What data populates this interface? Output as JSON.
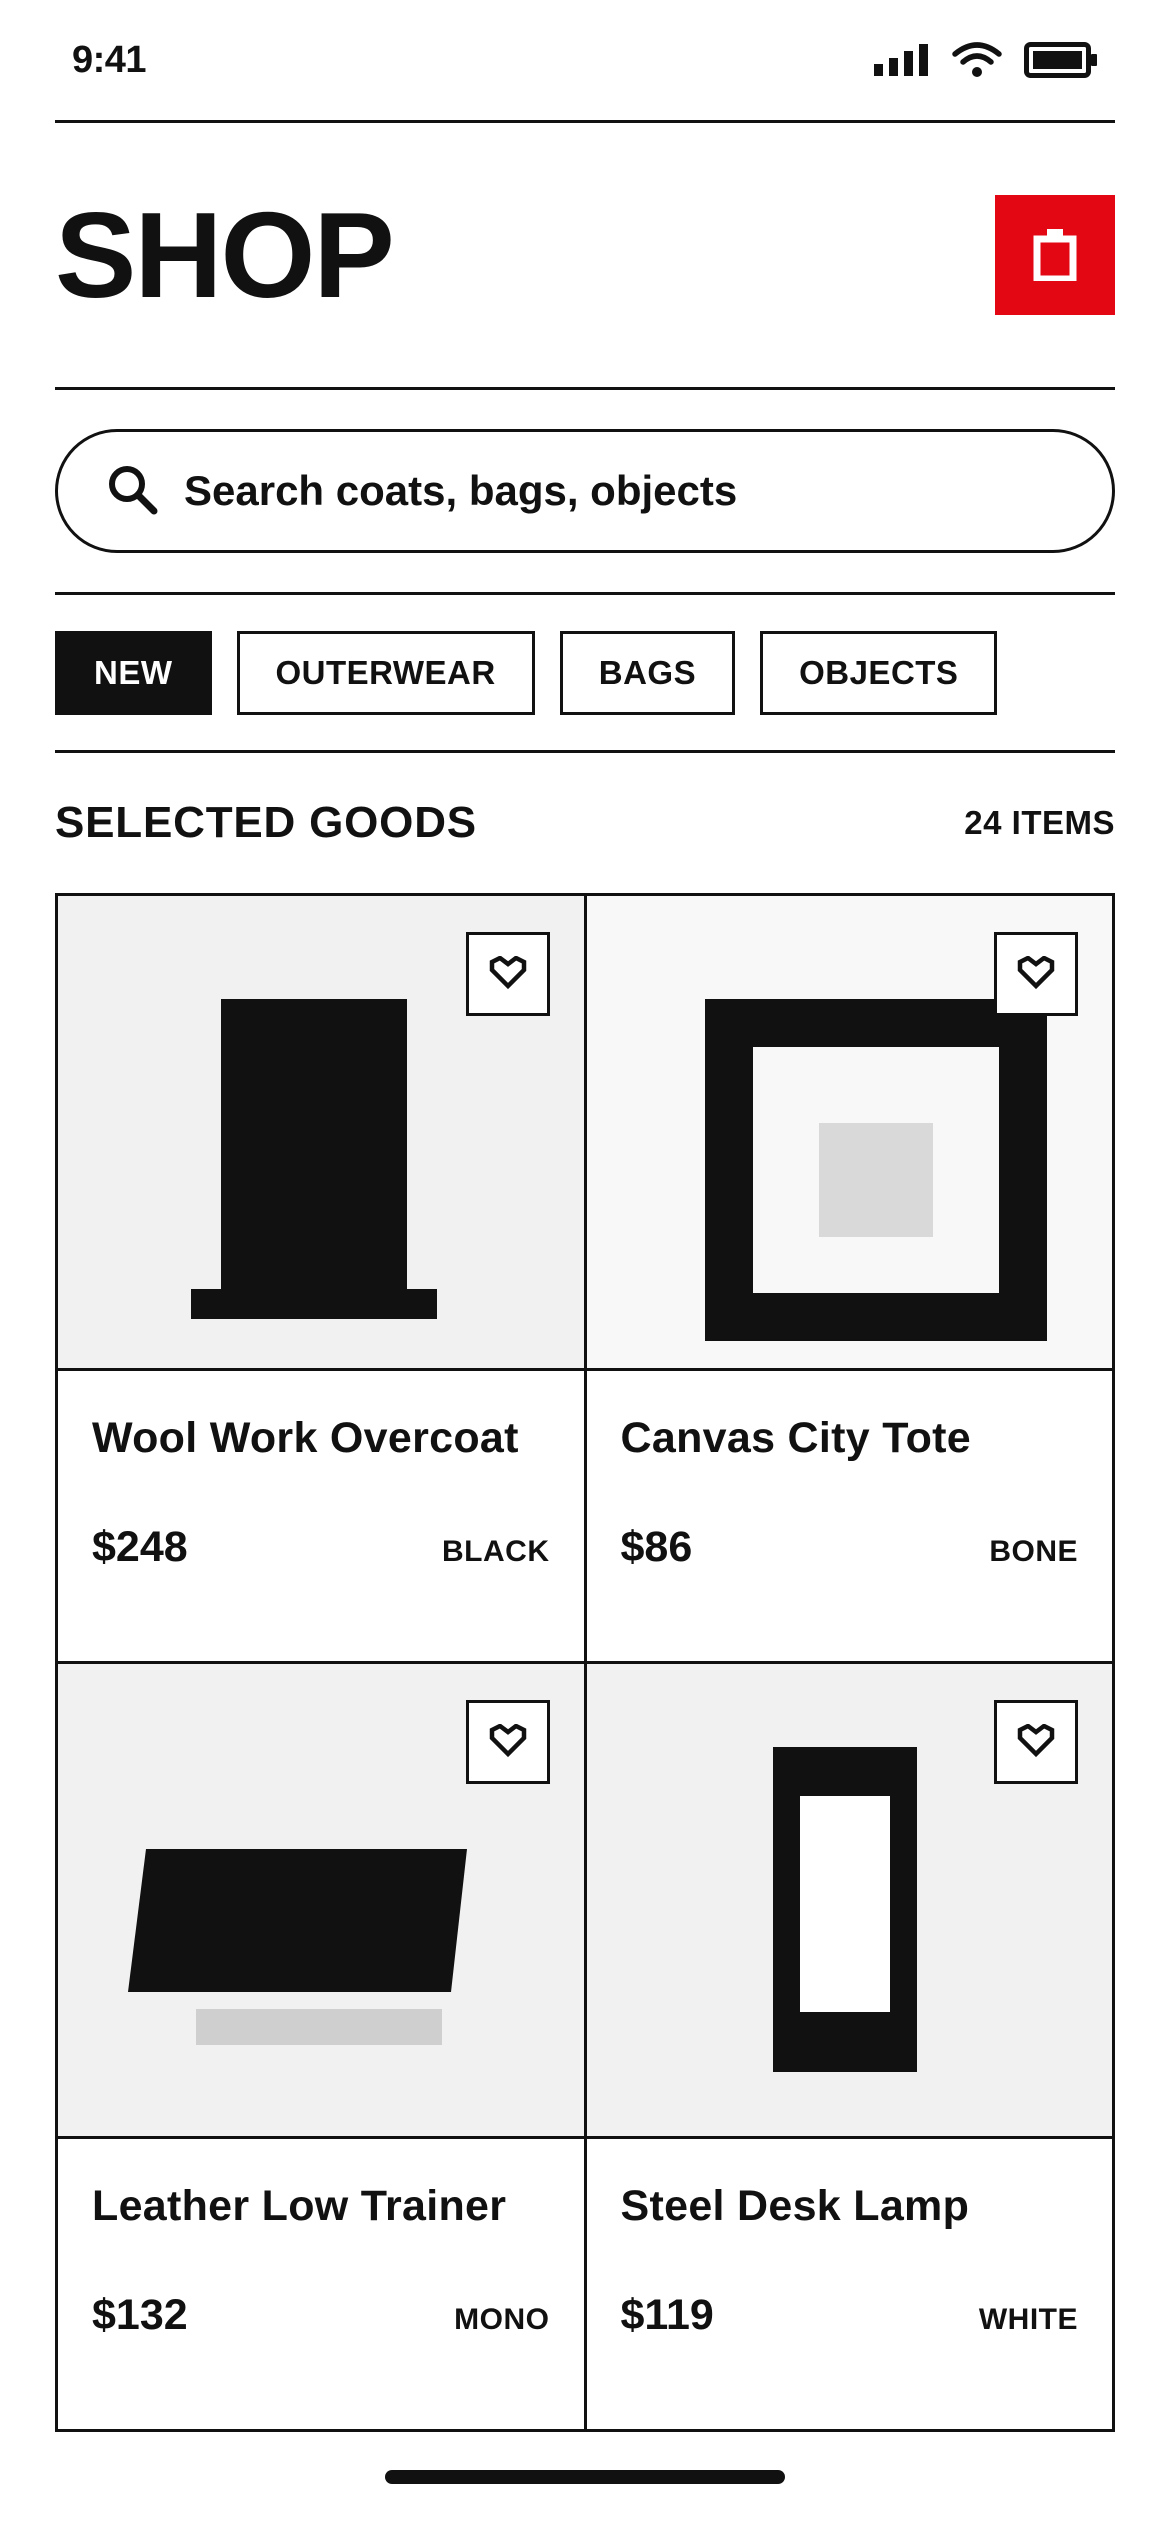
{
  "status_bar": {
    "time": "9:41",
    "icons": [
      "signal-icon",
      "wifi-icon",
      "battery-icon"
    ]
  },
  "header": {
    "title": "SHOP",
    "cart_icon": "shopping-bag-icon"
  },
  "search": {
    "placeholder": "Search coats, bags, objects",
    "value": "",
    "icon": "search-icon"
  },
  "filters": [
    {
      "label": "NEW",
      "active": true
    },
    {
      "label": "OUTERWEAR",
      "active": false
    },
    {
      "label": "BAGS",
      "active": false
    },
    {
      "label": "OBJECTS",
      "active": false
    }
  ],
  "section": {
    "title": "SELECTED GOODS",
    "count": "24 ITEMS"
  },
  "products": [
    {
      "name": "Wool Work Overcoat",
      "price": "$248",
      "color": "BLACK"
    },
    {
      "name": "Canvas City Tote",
      "price": "$86",
      "color": "BONE"
    },
    {
      "name": "Leather Low Trainer",
      "price": "$132",
      "color": "MONO"
    },
    {
      "name": "Steel Desk Lamp",
      "price": "$119",
      "color": "WHITE"
    }
  ],
  "colors": {
    "ink": "#111111",
    "accent": "#e30613",
    "tile_light": "#f1f1f1",
    "tile_lighter": "#f8f8f8",
    "placeholder_gray": "#d9d9d9"
  }
}
